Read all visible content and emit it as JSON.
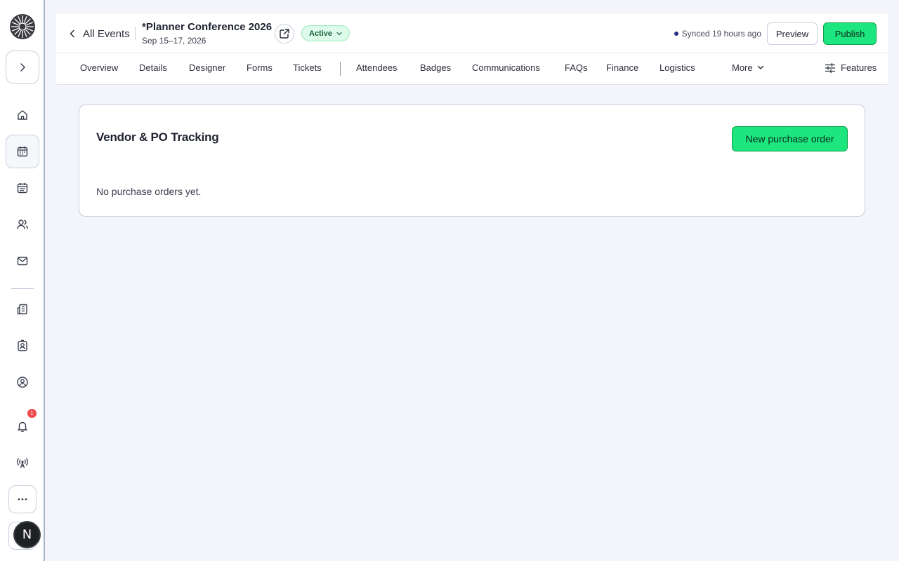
{
  "header": {
    "back_label": "All Events",
    "event_title": "*Planner Conference 2026",
    "event_dates": "Sep 15–17, 2026",
    "status": "Active",
    "sync_text": "Synced 19 hours ago",
    "preview_label": "Preview",
    "publish_label": "Publish"
  },
  "tabs": {
    "items": [
      "Overview",
      "Details",
      "Designer",
      "Forms",
      "Tickets",
      "Attendees",
      "Badges",
      "Communications",
      "FAQs",
      "Finance",
      "Logistics"
    ],
    "more_label": "More",
    "features_label": "Features"
  },
  "card": {
    "title": "Vendor & PO Tracking",
    "new_button_label": "New purchase order",
    "empty_text": "No purchase orders yet."
  },
  "sidebar": {
    "notification_count": "1",
    "avatar_initial": "N",
    "icons": [
      "home-icon",
      "calendar-icon",
      "calendar-list-icon",
      "people-icon",
      "mail-icon",
      "building-icon",
      "contact-badge-icon",
      "user-circle-icon",
      "bell-icon",
      "broadcast-icon"
    ]
  },
  "colors": {
    "accent_green": "#1de67f",
    "status_pill_bg": "#dcfbe9",
    "notification_red": "#ee4d4d",
    "page_bg": "#f4f5fb"
  }
}
